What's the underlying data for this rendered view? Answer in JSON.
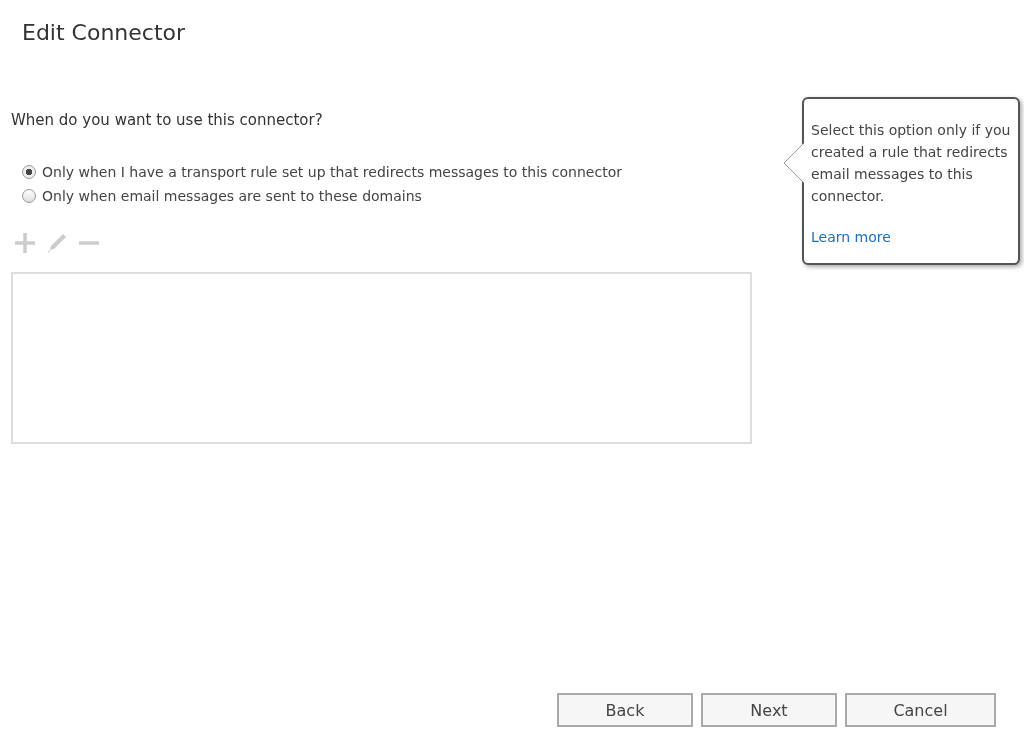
{
  "title": "Edit Connector",
  "question": "When do you want to use this connector?",
  "options": [
    {
      "label": "Only when I have a transport rule set up that redirects messages to this connector",
      "selected": true
    },
    {
      "label": "Only when email messages are sent to these domains",
      "selected": false
    }
  ],
  "toolbar": {
    "disabled": true
  },
  "callout": {
    "text": "Select this option only if you created a rule that redirects email messages to this connector.",
    "link": "Learn more"
  },
  "buttons": [
    "Back",
    "Next",
    "Cancel"
  ]
}
